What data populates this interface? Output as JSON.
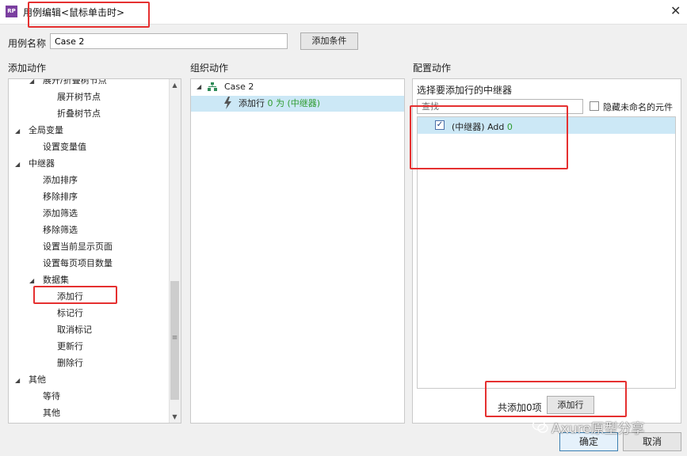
{
  "window": {
    "title": "用例编辑<鼠标单击时>",
    "app_icon": "RP",
    "close_glyph": "✕"
  },
  "case": {
    "label": "用例名称",
    "value": "Case 2",
    "add_condition_label": "添加条件"
  },
  "sections": {
    "add_action": "添加动作",
    "organize_action": "组织动作",
    "configure_action": "配置动作"
  },
  "tree": [
    {
      "label": "展开/折叠树节点",
      "level": 1,
      "expanded": true
    },
    {
      "label": "展开树节点",
      "level": 2
    },
    {
      "label": "折叠树节点",
      "level": 2
    },
    {
      "label": "全局变量",
      "level": 0,
      "expanded": true
    },
    {
      "label": "设置变量值",
      "level": 1
    },
    {
      "label": "中继器",
      "level": 0,
      "expanded": true
    },
    {
      "label": "添加排序",
      "level": 1
    },
    {
      "label": "移除排序",
      "level": 1
    },
    {
      "label": "添加筛选",
      "level": 1
    },
    {
      "label": "移除筛选",
      "level": 1
    },
    {
      "label": "设置当前显示页面",
      "level": 1
    },
    {
      "label": "设置每页项目数量",
      "level": 1
    },
    {
      "label": "数据集",
      "level": 1,
      "expanded": true
    },
    {
      "label": "添加行",
      "level": 2
    },
    {
      "label": "标记行",
      "level": 2
    },
    {
      "label": "取消标记",
      "level": 2
    },
    {
      "label": "更新行",
      "level": 2
    },
    {
      "label": "删除行",
      "level": 2
    },
    {
      "label": "其他",
      "level": 0,
      "expanded": true
    },
    {
      "label": "等待",
      "level": 1
    },
    {
      "label": "其他",
      "level": 1
    }
  ],
  "organize": {
    "case_name": "Case 2",
    "action_prefix": "添加行",
    "action_detail": "0 为 (中继器)"
  },
  "configure": {
    "select_label": "选择要添加行的中继器",
    "search_placeholder": "查找",
    "hide_unnamed_label": "隐藏未命名的元件",
    "hide_unnamed_checked": false,
    "repeater_item_name": "(中继器) Add",
    "repeater_item_count": "0",
    "repeater_item_checked": true,
    "check_glyph": "✓",
    "count_text": "共添加0项",
    "add_row_label": "添加行"
  },
  "footer": {
    "ok_label": "确定",
    "cancel_label": "取消"
  },
  "watermark": "Axure原型分享",
  "colors": {
    "selection": "#cce8f6",
    "highlight_box": "#e53030",
    "green_text": "#2e9b2e",
    "app_icon": "#7b3fa0"
  }
}
